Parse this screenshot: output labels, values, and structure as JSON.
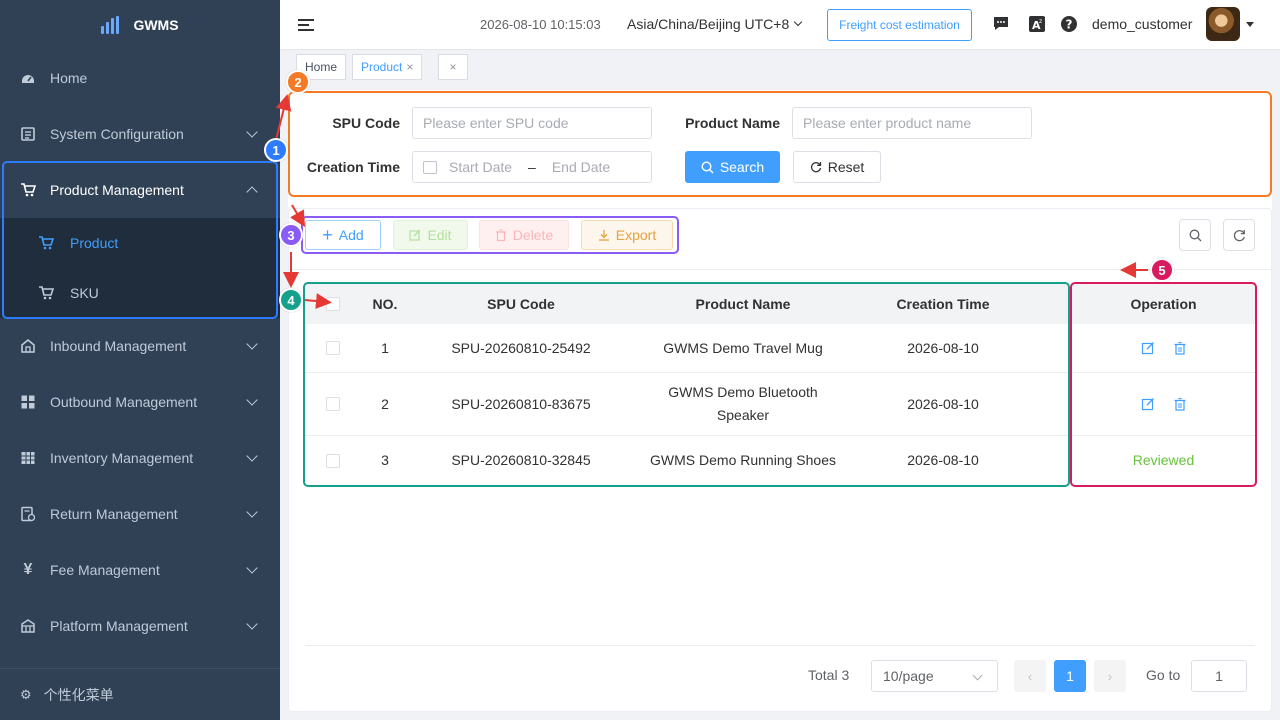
{
  "app": {
    "name": "GWMS"
  },
  "sidebar": {
    "items": [
      {
        "label": "Home",
        "icon": "dashboard-icon"
      },
      {
        "label": "System Configuration",
        "icon": "settings-doc-icon"
      },
      {
        "label": "Product Management",
        "icon": "cart-icon",
        "expanded": true
      },
      {
        "label": "Inbound Management",
        "icon": "warehouse-icon"
      },
      {
        "label": "Outbound Management",
        "icon": "grid-icon"
      },
      {
        "label": "Inventory Management",
        "icon": "table-icon"
      },
      {
        "label": "Return Management",
        "icon": "return-doc-icon"
      },
      {
        "label": "Fee Management",
        "icon": "yen-icon"
      },
      {
        "label": "Platform Management",
        "icon": "platform-icon"
      }
    ],
    "submenu": [
      {
        "label": "Product",
        "active": true
      },
      {
        "label": "SKU",
        "active": false
      }
    ],
    "footer_label": "个性化菜单"
  },
  "header": {
    "datetime": "2026-08-10 10:15:03",
    "timezone": "Asia/China/Beijing UTC+8",
    "freight_button": "Freight cost estimation",
    "username": "demo_customer"
  },
  "tabs": [
    {
      "label": "Home"
    },
    {
      "label": "Product",
      "active": true
    }
  ],
  "search_form": {
    "spu_label": "SPU Code",
    "spu_placeholder": "Please enter SPU code",
    "name_label": "Product Name",
    "name_placeholder": "Please enter product name",
    "time_label": "Creation Time",
    "start_placeholder": "Start Date",
    "range_separator": "–",
    "end_placeholder": "End Date",
    "search_button": "Search",
    "reset_button": "Reset"
  },
  "toolbar": {
    "add": "Add",
    "edit": "Edit",
    "delete": "Delete",
    "export": "Export"
  },
  "table": {
    "columns": [
      "NO.",
      "SPU Code",
      "Product Name",
      "Creation Time",
      "Operation"
    ],
    "rows": [
      {
        "no": "1",
        "spu": "SPU-20260810-25492",
        "name": "GWMS Demo Travel Mug",
        "time": "2026-08-10",
        "operation": "icons"
      },
      {
        "no": "2",
        "spu": "SPU-20260810-83675",
        "name": "GWMS Demo Bluetooth Speaker",
        "time": "2026-08-10",
        "operation": "icons"
      },
      {
        "no": "3",
        "spu": "SPU-20260810-32845",
        "name": "GWMS Demo Running Shoes",
        "time": "2026-08-10",
        "operation": "Reviewed"
      }
    ]
  },
  "pagination": {
    "total": "Total 3",
    "page_size": "10/page",
    "current_page": "1",
    "goto_label": "Go to",
    "goto_value": "1"
  },
  "annotations": {
    "markers": [
      "1",
      "2",
      "3",
      "4",
      "5"
    ],
    "colors": {
      "m1": "#2f7bff",
      "m2": "#f47a25",
      "m3": "#8a5cf6",
      "m4": "#14a08a",
      "m5": "#d81b60"
    }
  },
  "colors": {
    "sidebar_bg": "#304156",
    "submenu_bg": "#1f2d3d",
    "primary": "#409eff",
    "success": "#67c23a"
  }
}
